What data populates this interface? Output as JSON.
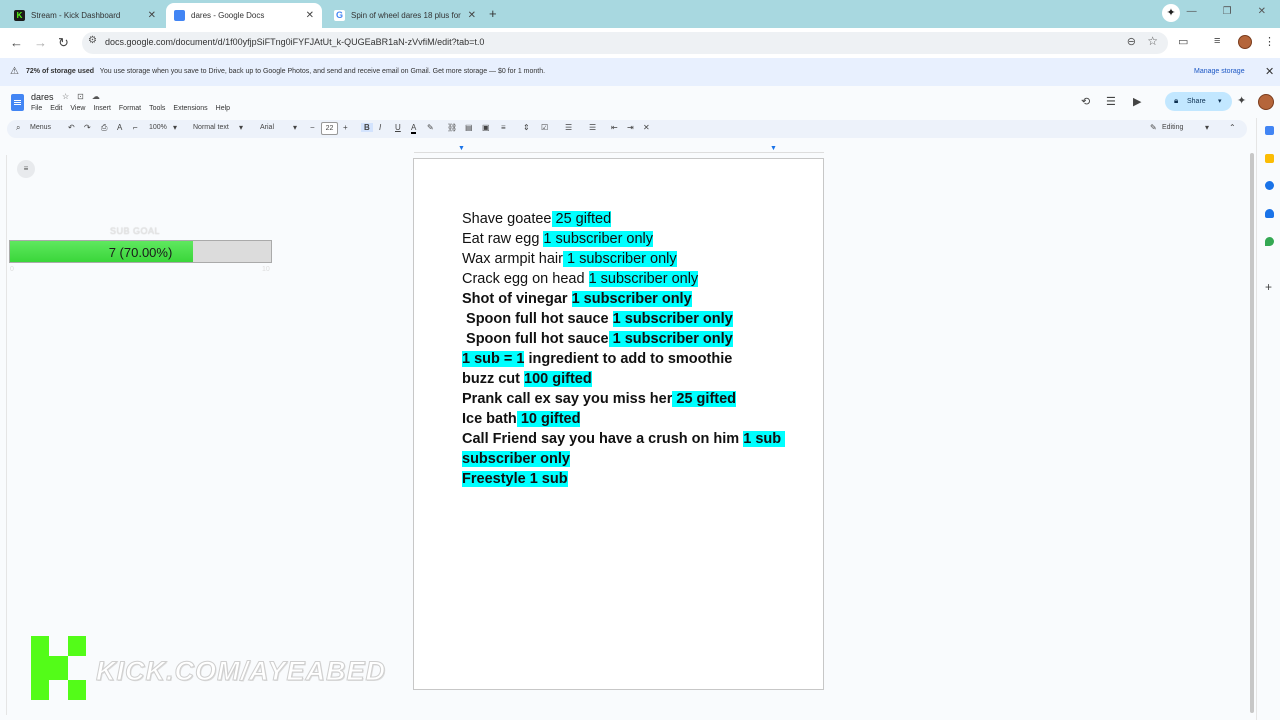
{
  "browser": {
    "tabs": [
      {
        "title": "Stream - Kick Dashboard",
        "active": false,
        "favicon": "kick-icon"
      },
      {
        "title": "dares - Google Docs",
        "active": true,
        "favicon": "docs-icon"
      },
      {
        "title": "Spin of wheel dares 18 plus for",
        "active": false,
        "favicon": "google-icon"
      }
    ],
    "url": "docs.google.com/document/d/1f00yfjpSiFTng0iFYFJAtUt_k-QUGEaBR1aN-zVvfiM/edit?tab=t.0"
  },
  "banner": {
    "storage": "72% of storage used",
    "message": "You use storage when you save to Drive, back up to Google Photos, and send and receive email on Gmail. Get more storage — $0 for 1 month.",
    "manage": "Manage storage"
  },
  "docs": {
    "title": "dares",
    "menus": [
      "File",
      "Edit",
      "View",
      "Insert",
      "Format",
      "Tools",
      "Extensions",
      "Help"
    ],
    "share_label": "Share",
    "toolbar": {
      "menus_label": "Menus",
      "zoom": "100%",
      "style": "Normal text",
      "font": "Arial",
      "font_size": "22",
      "mode": "Editing"
    }
  },
  "document": {
    "lines": [
      {
        "bold": false,
        "parts": [
          {
            "t": "Shave goatee",
            "hl": false
          },
          {
            "t": " 25 gifted",
            "hl": true
          }
        ]
      },
      {
        "bold": false,
        "parts": [
          {
            "t": "Eat raw egg ",
            "hl": false
          },
          {
            "t": "1 subscriber only",
            "hl": true
          }
        ]
      },
      {
        "bold": false,
        "parts": [
          {
            "t": "Wax armpit hair",
            "hl": false
          },
          {
            "t": " 1 subscriber only",
            "hl": true
          }
        ]
      },
      {
        "bold": false,
        "parts": [
          {
            "t": "Crack egg on head ",
            "hl": false
          },
          {
            "t": "1 subscriber only",
            "hl": true
          }
        ]
      },
      {
        "bold": true,
        "parts": [
          {
            "t": "Shot of vinegar ",
            "hl": false
          },
          {
            "t": "1 subscriber only",
            "hl": true
          }
        ]
      },
      {
        "bold": true,
        "parts": [
          {
            "t": " Spoon full hot sauce ",
            "hl": false
          },
          {
            "t": "1 subscriber only",
            "hl": true
          }
        ]
      },
      {
        "bold": true,
        "parts": [
          {
            "t": " Spoon full hot sauce",
            "hl": false
          },
          {
            "t": " 1 subscriber only",
            "hl": true
          }
        ]
      },
      {
        "bold": true,
        "parts": [
          {
            "t": "1 sub = 1",
            "hl": true
          },
          {
            "t": " ingredient to add to smoothie",
            "hl": false
          }
        ]
      },
      {
        "bold": true,
        "parts": [
          {
            "t": "buzz cut ",
            "hl": false
          },
          {
            "t": "100 gifted",
            "hl": true
          }
        ]
      },
      {
        "bold": true,
        "parts": [
          {
            "t": "Prank call ex say you miss her",
            "hl": false
          },
          {
            "t": " 25 gifted",
            "hl": true
          }
        ]
      },
      {
        "bold": true,
        "parts": [
          {
            "t": "Ice bath",
            "hl": false
          },
          {
            "t": " 10 gifted",
            "hl": true
          }
        ]
      },
      {
        "bold": true,
        "parts": [
          {
            "t": "Call Friend say you have a crush on him ",
            "hl": false
          },
          {
            "t": "1 sub subscriber only",
            "hl": true
          }
        ]
      },
      {
        "bold": true,
        "parts": [
          {
            "t": "Freestyle 1 sub",
            "hl": true
          }
        ]
      }
    ]
  },
  "overlay": {
    "goal_title": "SUB GOAL",
    "goal_text": "7 (70.00%)",
    "goal_fraction": 0.7,
    "goal_min": "0",
    "goal_max": "10",
    "kick_url": "KICK.COM/AYEABED"
  },
  "colors": {
    "highlight": "#00ffff",
    "kick_green": "#53fc18",
    "tab_strip": "#a8d8e0"
  }
}
